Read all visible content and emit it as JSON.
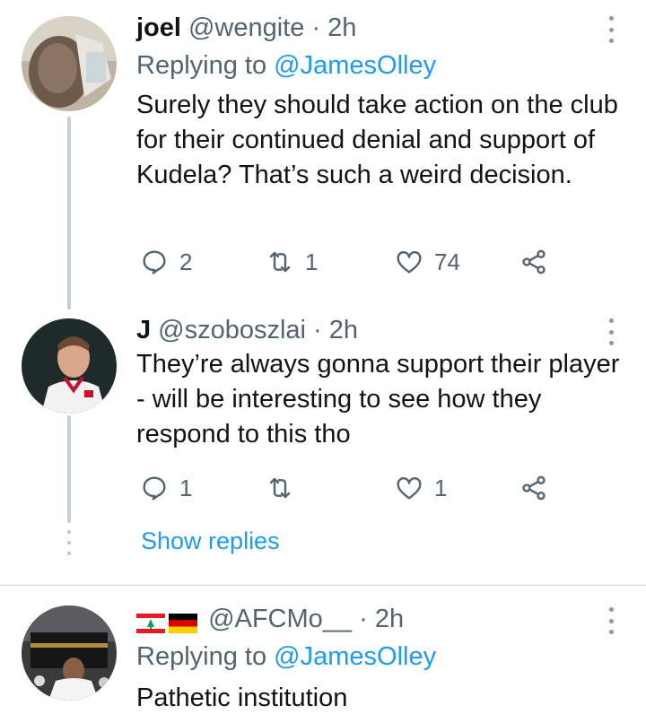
{
  "tweets": [
    {
      "name": "joel",
      "handle": "@wengite",
      "time": "· 2h",
      "replying_label": "Replying to",
      "replying_to": "@JamesOlley",
      "text": "Surely they should take action on the club for their continued denial and support of Kudela? That’s such a weird decision.",
      "replies": "2",
      "retweets": "1",
      "likes": "74"
    },
    {
      "name": "J",
      "handle": "@szoboszlai",
      "time": "· 2h",
      "text": "They’re always gonna support their player - will be interesting to see how they respond to this tho",
      "replies": "1",
      "retweets": "",
      "likes": "1"
    },
    {
      "name_flags": [
        "lebanon-flag",
        "germany-flag"
      ],
      "handle": "@AFCMo__",
      "time": "· 2h",
      "replying_label": "Replying to",
      "replying_to": "@JamesOlley",
      "text": "Pathetic institution"
    }
  ],
  "show_replies": "Show replies",
  "colors": {
    "accent": "#1d9bf0",
    "secondary_text": "#536471",
    "thread_line": "#c4cfd6"
  }
}
